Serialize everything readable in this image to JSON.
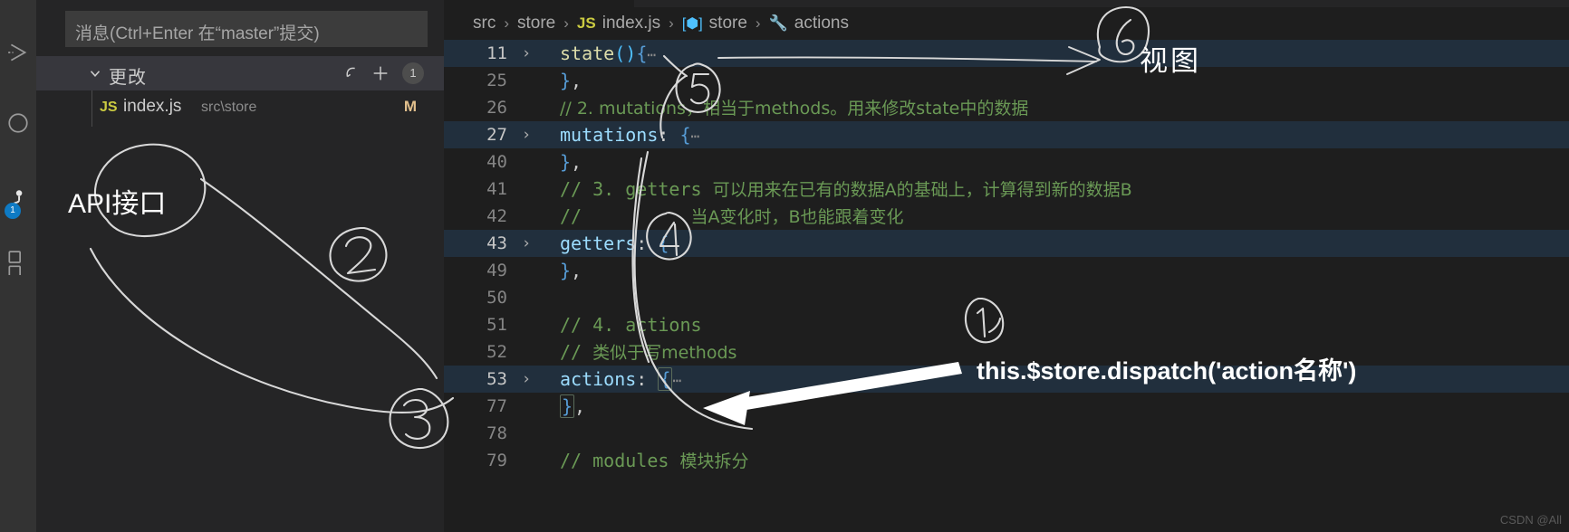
{
  "activity_bar": {
    "items": [
      {
        "name": "run-and-debug-icon",
        "icon": "play-triangle-icon"
      },
      {
        "name": "debug-console-icon",
        "icon": "circle-icon"
      },
      {
        "name": "source-control-icon",
        "icon": "source-control-icon",
        "badge": "1"
      },
      {
        "name": "extensions-icon",
        "icon": "squares-icon"
      }
    ]
  },
  "sidebar": {
    "commit_input": {
      "placeholder": "消息(Ctrl+Enter 在“master”提交)",
      "value": ""
    },
    "changes_section": {
      "chevron": "⌄",
      "title": "更改",
      "undo_label": "↺",
      "stage_all_label": "+",
      "count": "1"
    },
    "changed_files": [
      {
        "badge": "JS",
        "name": "index.js",
        "path": "src\\store",
        "status": "M"
      }
    ]
  },
  "editor": {
    "breadcrumb": [
      {
        "label": "src",
        "icon": ""
      },
      {
        "label": "store",
        "icon": ""
      },
      {
        "label": "index.js",
        "icon": "js-file-icon"
      },
      {
        "label": "store",
        "icon": "symbol-object-icon"
      },
      {
        "label": "actions",
        "icon": "symbol-method-icon"
      }
    ],
    "lines": [
      {
        "num": "11",
        "fold": "›",
        "highlight": true,
        "segments": [
          {
            "t": "state",
            "c": "tok-fn"
          },
          {
            "t": "()",
            "c": "tok-paren"
          },
          {
            "t": "{",
            "c": "tok-brace"
          },
          {
            "t": "⋯",
            "c": "ellipsis"
          }
        ]
      },
      {
        "num": "25",
        "fold": "",
        "highlight": false,
        "segments": [
          {
            "t": "}",
            "c": "tok-brace"
          },
          {
            "t": ",",
            "c": "tok-punc"
          }
        ]
      },
      {
        "num": "26",
        "fold": "",
        "highlight": false,
        "segments": [
          {
            "t": "// 2. mutations，相当于methods。用来修改state中的数据",
            "c": "tok-comment-cjk"
          }
        ]
      },
      {
        "num": "27",
        "fold": "›",
        "highlight": true,
        "segments": [
          {
            "t": "mutations",
            "c": "tok-prop"
          },
          {
            "t": ": ",
            "c": "tok-punc"
          },
          {
            "t": "{",
            "c": "tok-brace"
          },
          {
            "t": "⋯",
            "c": "ellipsis"
          }
        ]
      },
      {
        "num": "40",
        "fold": "",
        "highlight": false,
        "segments": [
          {
            "t": "}",
            "c": "tok-brace"
          },
          {
            "t": ",",
            "c": "tok-punc"
          }
        ]
      },
      {
        "num": "41",
        "fold": "",
        "highlight": false,
        "segments": [
          {
            "t": "// 3. getters ",
            "c": "tok-comment"
          },
          {
            "t": "可以用来在已有的数据A的基础上，计算得到新的数据B",
            "c": "tok-comment-cjk"
          }
        ]
      },
      {
        "num": "42",
        "fold": "",
        "highlight": false,
        "segments": [
          {
            "t": "//          ",
            "c": "tok-comment"
          },
          {
            "t": "当A变化时，B也能跟着变化",
            "c": "tok-comment-cjk"
          }
        ]
      },
      {
        "num": "43",
        "fold": "›",
        "highlight": true,
        "segments": [
          {
            "t": "getters",
            "c": "tok-prop"
          },
          {
            "t": ": ",
            "c": "tok-punc"
          },
          {
            "t": "{",
            "c": "tok-brace"
          }
        ]
      },
      {
        "num": "49",
        "fold": "",
        "highlight": false,
        "segments": [
          {
            "t": "}",
            "c": "tok-brace"
          },
          {
            "t": ",",
            "c": "tok-punc"
          }
        ]
      },
      {
        "num": "50",
        "fold": "",
        "highlight": false,
        "segments": []
      },
      {
        "num": "51",
        "fold": "",
        "highlight": false,
        "segments": [
          {
            "t": "// 4. actions",
            "c": "tok-comment"
          }
        ]
      },
      {
        "num": "52",
        "fold": "",
        "highlight": false,
        "segments": [
          {
            "t": "// ",
            "c": "tok-comment"
          },
          {
            "t": "类似于写methods",
            "c": "tok-comment-cjk"
          }
        ]
      },
      {
        "num": "53",
        "fold": "›",
        "highlight": true,
        "segments": [
          {
            "t": "actions",
            "c": "tok-prop"
          },
          {
            "t": ": ",
            "c": "tok-punc"
          },
          {
            "t": "{",
            "c": "tok-brace brace-box"
          },
          {
            "t": "⋯",
            "c": "ellipsis"
          }
        ]
      },
      {
        "num": "77",
        "fold": "",
        "highlight": false,
        "segments": [
          {
            "t": "}",
            "c": "tok-brace brace-box"
          },
          {
            "t": ",",
            "c": "tok-punc"
          }
        ]
      },
      {
        "num": "78",
        "fold": "",
        "highlight": false,
        "segments": []
      },
      {
        "num": "79",
        "fold": "",
        "highlight": false,
        "segments": [
          {
            "t": "// modules ",
            "c": "tok-comment"
          },
          {
            "t": "模块拆分",
            "c": "tok-comment-cjk"
          }
        ]
      }
    ]
  },
  "annotations": {
    "view_label": "视图",
    "api_label": "API接口",
    "dispatch_label": "this.$store.dispatch('action名称')",
    "circled_numbers": [
      "1",
      "2",
      "3",
      "4",
      "5",
      "6"
    ]
  },
  "watermark": "CSDN @All"
}
